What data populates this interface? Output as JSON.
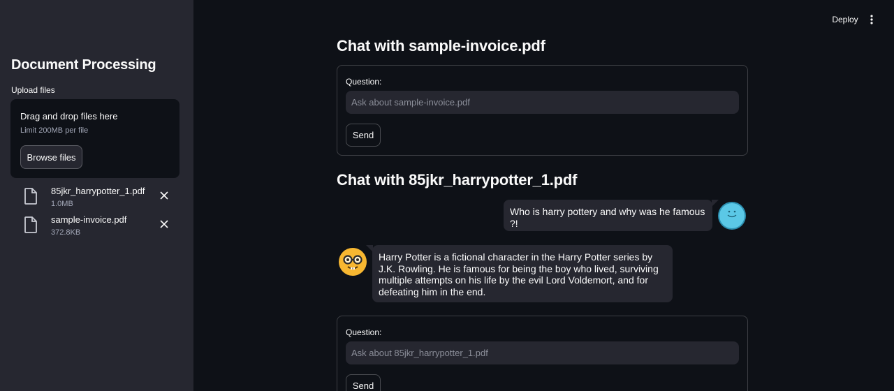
{
  "header": {
    "deploy_label": "Deploy",
    "menu_icon": "more-vertical-icon"
  },
  "sidebar": {
    "title": "Document Processing",
    "upload_label": "Upload files",
    "dropzone": {
      "title": "Drag and drop files here",
      "limit": "Limit 200MB per file",
      "browse_label": "Browse files"
    },
    "files": [
      {
        "name": "85jkr_harrypotter_1.pdf",
        "size": "1.0MB",
        "icon": "file-icon",
        "remove_icon": "close-icon"
      },
      {
        "name": "sample-invoice.pdf",
        "size": "372.8KB",
        "icon": "file-icon",
        "remove_icon": "close-icon"
      }
    ]
  },
  "main": {
    "chats": [
      {
        "title": "Chat with sample-invoice.pdf",
        "question_label": "Question:",
        "placeholder": "Ask about sample-invoice.pdf",
        "send_label": "Send",
        "messages": []
      },
      {
        "title": "Chat with 85jkr_harrypotter_1.pdf",
        "question_label": "Question:",
        "placeholder": "Ask about 85jkr_harrypotter_1.pdf",
        "send_label": "Send",
        "messages": [
          {
            "role": "user",
            "avatar": "smiley-avatar-icon",
            "text": "Who is harry pottery and why was he famous ?!"
          },
          {
            "role": "assistant",
            "avatar": "nerd-face-avatar-icon",
            "text": "Harry Potter is a fictional character in the Harry Potter series by J.K. Rowling. He is famous for being the boy who lived, surviving multiple attempts on his life by the evil Lord Voldemort, and for defeating him in the end."
          }
        ]
      }
    ]
  },
  "colors": {
    "background": "#0e1117",
    "sidebar": "#262730",
    "text": "#fafafa",
    "muted_text": "#a3a8b8",
    "user_avatar": "#5bc8e6",
    "bot_avatar": "#f7b731"
  }
}
